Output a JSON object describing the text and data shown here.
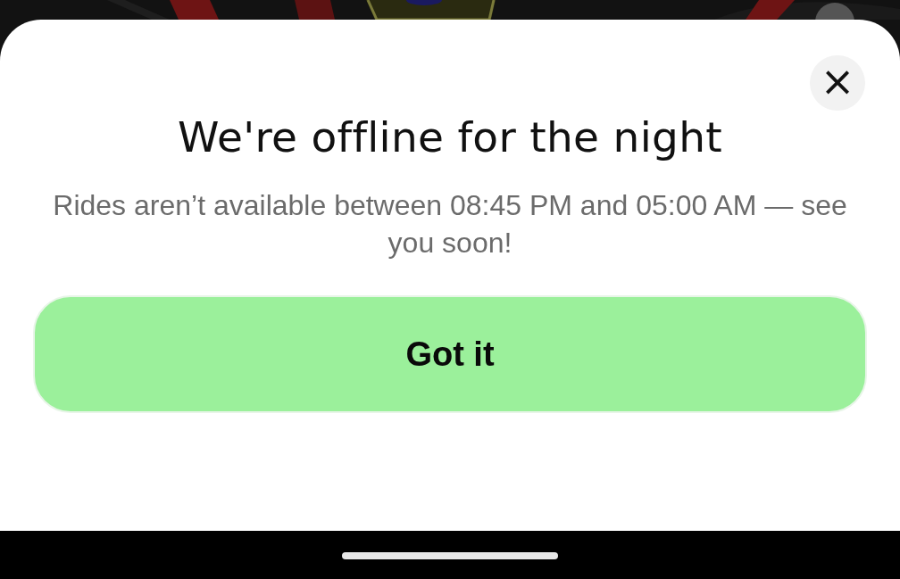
{
  "dialog": {
    "close": "×",
    "title": "We're offline for the night",
    "message": "Rides aren’t available between 08:45 PM and 05:00 AM — see you soon!",
    "button": "Got it"
  }
}
